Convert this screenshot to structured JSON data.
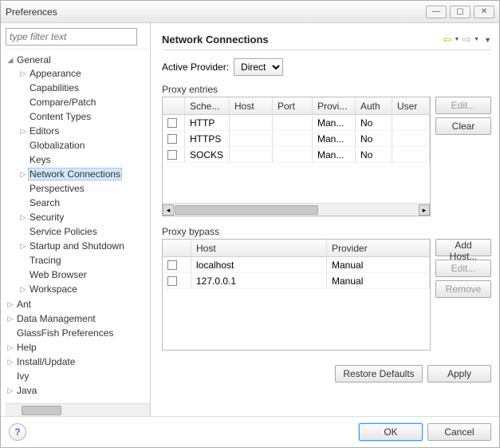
{
  "window": {
    "title": "Preferences"
  },
  "filter": {
    "placeholder": "type filter text"
  },
  "tree": {
    "general": "General",
    "items": [
      "Appearance",
      "Capabilities",
      "Compare/Patch",
      "Content Types",
      "Editors",
      "Globalization",
      "Keys",
      "Network Connections",
      "Perspectives",
      "Search",
      "Security",
      "Service Policies",
      "Startup and Shutdown",
      "Tracing",
      "Web Browser",
      "Workspace"
    ],
    "rest": [
      "Ant",
      "Data Management",
      "GlassFish Preferences",
      "Help",
      "Install/Update",
      "Ivy",
      "Java"
    ]
  },
  "page": {
    "title": "Network Connections",
    "provider_label": "Active Provider:",
    "provider_value": "Direct"
  },
  "proxy": {
    "label": "Proxy entries",
    "headers": {
      "sche": "Sche...",
      "host": "Host",
      "port": "Port",
      "prov": "Provi...",
      "auth": "Auth",
      "user": "User"
    },
    "rows": [
      {
        "sche": "HTTP",
        "host": "",
        "port": "",
        "prov": "Man...",
        "auth": "No",
        "user": ""
      },
      {
        "sche": "HTTPS",
        "host": "",
        "port": "",
        "prov": "Man...",
        "auth": "No",
        "user": ""
      },
      {
        "sche": "SOCKS",
        "host": "",
        "port": "",
        "prov": "Man...",
        "auth": "No",
        "user": ""
      }
    ],
    "buttons": {
      "edit": "Edit...",
      "clear": "Clear"
    }
  },
  "bypass": {
    "label": "Proxy bypass",
    "headers": {
      "host": "Host",
      "prov": "Provider"
    },
    "rows": [
      {
        "host": "localhost",
        "prov": "Manual"
      },
      {
        "host": "127.0.0.1",
        "prov": "Manual"
      }
    ],
    "buttons": {
      "add": "Add Host...",
      "edit": "Edit...",
      "remove": "Remove"
    }
  },
  "footer": {
    "restore": "Restore Defaults",
    "apply": "Apply",
    "ok": "OK",
    "cancel": "Cancel",
    "help": "?"
  }
}
